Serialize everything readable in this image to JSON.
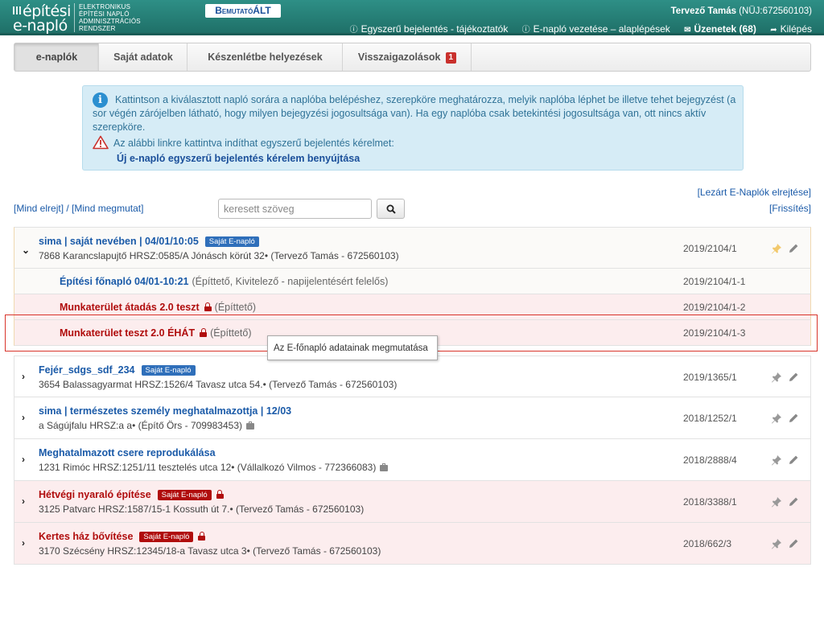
{
  "header": {
    "logo_line1": "építési",
    "logo_line2": "e-napló",
    "system_name": [
      "ELEKTRONIKUS",
      "ÉPÍTÉSI NAPLÓ",
      "ADMINISZTRÁCIÓS",
      "RENDSZER"
    ],
    "demo_badge": "BemutatóÁLT",
    "user_name": "Tervező Tamás",
    "user_id": "(NÜJ:672560103)",
    "nav": {
      "simple_report": "Egyszerű bejelentés - tájékoztatók",
      "enaplo_basics": "E-napló vezetése – alaplépések",
      "messages": "Üzenetek (68)",
      "logout": "Kilépés"
    }
  },
  "tabs": {
    "enaplok": "e-naplók",
    "sajat_adatok": "Saját adatok",
    "keszenlet": "Készenlétbe helyezések",
    "visszaigazolasok": "Visszaigazolások",
    "visszaigazolasok_count": "1"
  },
  "info": {
    "text": "Kattintson a kiválasztott napló sorára a naplóba belépéshez, szerepköre meghatározza, melyik naplóba léphet be illetve tehet bejegyzést (a sor végén zárójelben látható, hogy milyen bejegyzési jogosultsága van). Ha egy naplóba csak betekintési jogosultsága van, ott nincs aktív szerepköre.",
    "warning_text": "Az alábbi linkre kattintva indíthat egyszerű bejelentés kérelmet:",
    "link": "Új e-napló egyszerű bejelentés kérelem benyújtása"
  },
  "filters": {
    "hide_all": "[Mind elrejt]",
    "sep": "/",
    "show_all": "[Mind megmutat]",
    "search_placeholder": "keresett szöveg",
    "hide_closed": "[Lezárt E-Naplók elrejtése]",
    "refresh": "[Frissítés]"
  },
  "rows": {
    "r0": {
      "title": "sima | saját nevében | 04/01/10:05",
      "tag": "Saját E-napló",
      "sub": "7868 Karancslapujtő HRSZ:0585/A Jónásch körút 32• (Tervező Tamás - 672560103)",
      "code": "2019/2104/1"
    },
    "s1": {
      "title": "Építési főnapló 04/01-10:21",
      "role": "(Építtető, Kivitelező - napijelentésért felelős)",
      "code": "2019/2104/1-1"
    },
    "s2": {
      "title": "Munkaterület átadás 2.0 teszt",
      "role": "(Építtető)",
      "code": "2019/2104/1-2"
    },
    "s3": {
      "title": "Munkaterület teszt 2.0 ÉHÁT",
      "role": "(Építtető)",
      "code": "2019/2104/1-3"
    },
    "r1": {
      "title": "Fejér_sdgs_sdf_234",
      "tag": "Saját E-napló",
      "sub": "3654 Balassagyarmat HRSZ:1526/4 Tavasz utca 54.• (Tervező Tamás - 672560103)",
      "code": "2019/1365/1"
    },
    "r2": {
      "title": "sima | természetes személy meghatalmazottja | 12/03",
      "sub": "a Ságújfalu HRSZ:a a• (Építő Örs - 709983453)",
      "code": "2018/1252/1"
    },
    "r3": {
      "title": "Meghatalmazott csere reprodukálása",
      "sub": "1231 Rimóc HRSZ:1251/11 tesztelés utca 12• (Vállalkozó Vilmos - 772366083)",
      "code": "2018/2888/4"
    },
    "r4": {
      "title": "Hétvégi nyaraló építése",
      "tag": "Saját E-napló",
      "sub": "3125 Patvarc HRSZ:1587/15-1 Kossuth út 7.• (Tervező Tamás - 672560103)",
      "code": "2018/3388/1"
    },
    "r5": {
      "title": "Kertes ház bővítése",
      "tag": "Saját E-napló",
      "sub": "3170 Szécsény HRSZ:12345/18-a Tavasz utca 3• (Tervező Tamás - 672560103)",
      "code": "2018/662/3"
    }
  },
  "tooltip": "Az E-főnapló adatainak megmutatása",
  "colors": {
    "header": "#2e8f86",
    "link_blue": "#1a5aa8",
    "alert_red": "#b00d0d",
    "info_bg": "#d6ecf6",
    "pink_row": "#fcedee"
  }
}
